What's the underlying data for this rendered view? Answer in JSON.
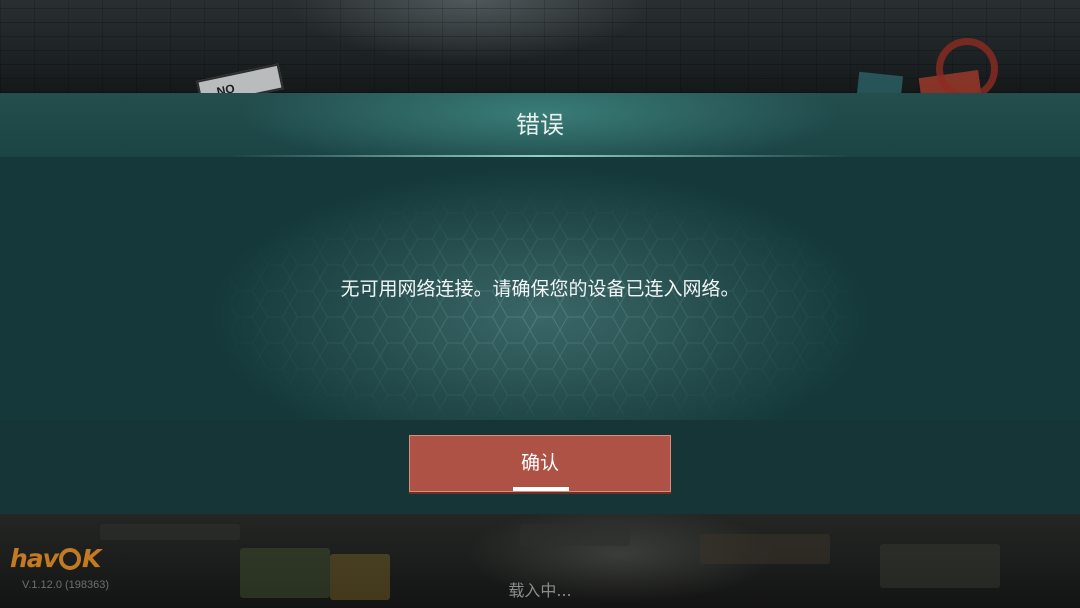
{
  "background": {
    "sign_text": "NO"
  },
  "dialog": {
    "title": "错误",
    "message": "无可用网络连接。请确保您的设备已连入网络。",
    "confirm_label": "确认"
  },
  "footer": {
    "logo_text_prefix": "hav",
    "logo_text_suffix": "K",
    "version": "V.1.12.0 (198363)",
    "loading_text": "载入中..."
  },
  "colors": {
    "dialog_bg": "#15393a",
    "header_accent": "#3c827d",
    "confirm_button": "#ad5244",
    "logo": "#c27a24"
  }
}
